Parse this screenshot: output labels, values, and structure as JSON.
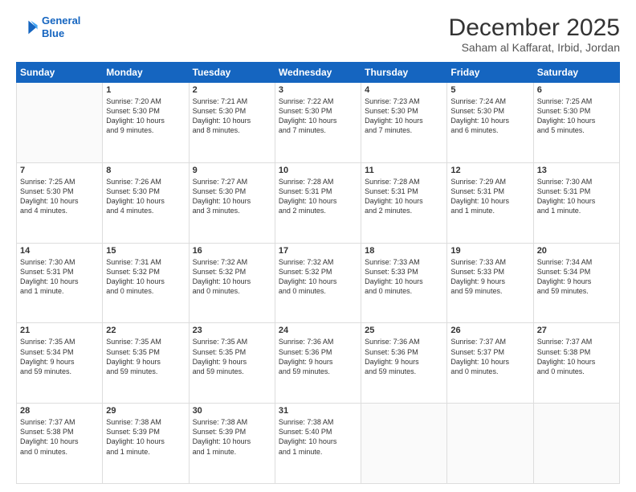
{
  "logo": {
    "line1": "General",
    "line2": "Blue"
  },
  "title": "December 2025",
  "location": "Saham al Kaffarat, Irbid, Jordan",
  "days_header": [
    "Sunday",
    "Monday",
    "Tuesday",
    "Wednesday",
    "Thursday",
    "Friday",
    "Saturday"
  ],
  "weeks": [
    [
      {
        "num": "",
        "info": ""
      },
      {
        "num": "1",
        "info": "Sunrise: 7:20 AM\nSunset: 5:30 PM\nDaylight: 10 hours\nand 9 minutes."
      },
      {
        "num": "2",
        "info": "Sunrise: 7:21 AM\nSunset: 5:30 PM\nDaylight: 10 hours\nand 8 minutes."
      },
      {
        "num": "3",
        "info": "Sunrise: 7:22 AM\nSunset: 5:30 PM\nDaylight: 10 hours\nand 7 minutes."
      },
      {
        "num": "4",
        "info": "Sunrise: 7:23 AM\nSunset: 5:30 PM\nDaylight: 10 hours\nand 7 minutes."
      },
      {
        "num": "5",
        "info": "Sunrise: 7:24 AM\nSunset: 5:30 PM\nDaylight: 10 hours\nand 6 minutes."
      },
      {
        "num": "6",
        "info": "Sunrise: 7:25 AM\nSunset: 5:30 PM\nDaylight: 10 hours\nand 5 minutes."
      }
    ],
    [
      {
        "num": "7",
        "info": "Sunrise: 7:25 AM\nSunset: 5:30 PM\nDaylight: 10 hours\nand 4 minutes."
      },
      {
        "num": "8",
        "info": "Sunrise: 7:26 AM\nSunset: 5:30 PM\nDaylight: 10 hours\nand 4 minutes."
      },
      {
        "num": "9",
        "info": "Sunrise: 7:27 AM\nSunset: 5:30 PM\nDaylight: 10 hours\nand 3 minutes."
      },
      {
        "num": "10",
        "info": "Sunrise: 7:28 AM\nSunset: 5:31 PM\nDaylight: 10 hours\nand 2 minutes."
      },
      {
        "num": "11",
        "info": "Sunrise: 7:28 AM\nSunset: 5:31 PM\nDaylight: 10 hours\nand 2 minutes."
      },
      {
        "num": "12",
        "info": "Sunrise: 7:29 AM\nSunset: 5:31 PM\nDaylight: 10 hours\nand 1 minute."
      },
      {
        "num": "13",
        "info": "Sunrise: 7:30 AM\nSunset: 5:31 PM\nDaylight: 10 hours\nand 1 minute."
      }
    ],
    [
      {
        "num": "14",
        "info": "Sunrise: 7:30 AM\nSunset: 5:31 PM\nDaylight: 10 hours\nand 1 minute."
      },
      {
        "num": "15",
        "info": "Sunrise: 7:31 AM\nSunset: 5:32 PM\nDaylight: 10 hours\nand 0 minutes."
      },
      {
        "num": "16",
        "info": "Sunrise: 7:32 AM\nSunset: 5:32 PM\nDaylight: 10 hours\nand 0 minutes."
      },
      {
        "num": "17",
        "info": "Sunrise: 7:32 AM\nSunset: 5:32 PM\nDaylight: 10 hours\nand 0 minutes."
      },
      {
        "num": "18",
        "info": "Sunrise: 7:33 AM\nSunset: 5:33 PM\nDaylight: 10 hours\nand 0 minutes."
      },
      {
        "num": "19",
        "info": "Sunrise: 7:33 AM\nSunset: 5:33 PM\nDaylight: 9 hours\nand 59 minutes."
      },
      {
        "num": "20",
        "info": "Sunrise: 7:34 AM\nSunset: 5:34 PM\nDaylight: 9 hours\nand 59 minutes."
      }
    ],
    [
      {
        "num": "21",
        "info": "Sunrise: 7:35 AM\nSunset: 5:34 PM\nDaylight: 9 hours\nand 59 minutes."
      },
      {
        "num": "22",
        "info": "Sunrise: 7:35 AM\nSunset: 5:35 PM\nDaylight: 9 hours\nand 59 minutes."
      },
      {
        "num": "23",
        "info": "Sunrise: 7:35 AM\nSunset: 5:35 PM\nDaylight: 9 hours\nand 59 minutes."
      },
      {
        "num": "24",
        "info": "Sunrise: 7:36 AM\nSunset: 5:36 PM\nDaylight: 9 hours\nand 59 minutes."
      },
      {
        "num": "25",
        "info": "Sunrise: 7:36 AM\nSunset: 5:36 PM\nDaylight: 9 hours\nand 59 minutes."
      },
      {
        "num": "26",
        "info": "Sunrise: 7:37 AM\nSunset: 5:37 PM\nDaylight: 10 hours\nand 0 minutes."
      },
      {
        "num": "27",
        "info": "Sunrise: 7:37 AM\nSunset: 5:38 PM\nDaylight: 10 hours\nand 0 minutes."
      }
    ],
    [
      {
        "num": "28",
        "info": "Sunrise: 7:37 AM\nSunset: 5:38 PM\nDaylight: 10 hours\nand 0 minutes."
      },
      {
        "num": "29",
        "info": "Sunrise: 7:38 AM\nSunset: 5:39 PM\nDaylight: 10 hours\nand 1 minute."
      },
      {
        "num": "30",
        "info": "Sunrise: 7:38 AM\nSunset: 5:39 PM\nDaylight: 10 hours\nand 1 minute."
      },
      {
        "num": "31",
        "info": "Sunrise: 7:38 AM\nSunset: 5:40 PM\nDaylight: 10 hours\nand 1 minute."
      },
      {
        "num": "",
        "info": ""
      },
      {
        "num": "",
        "info": ""
      },
      {
        "num": "",
        "info": ""
      }
    ]
  ]
}
